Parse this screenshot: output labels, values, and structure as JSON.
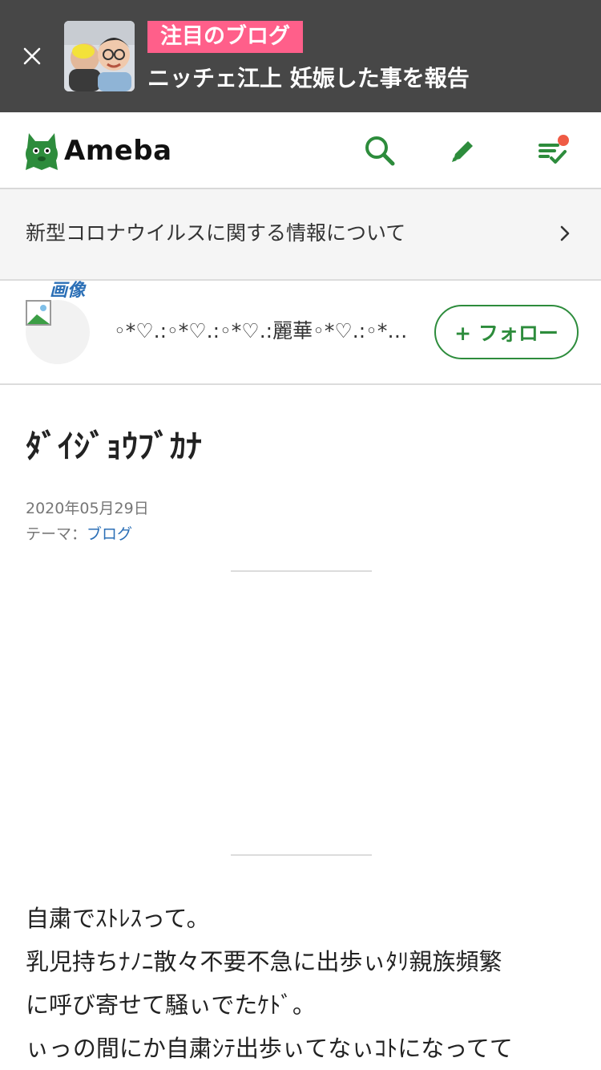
{
  "banner": {
    "tag": "注目のブログ",
    "headline": "ニッチェ江上 妊娠した事を報告"
  },
  "header": {
    "logo_text": "Ameba"
  },
  "info_bar": {
    "text": "新型コロナウイルスに関する情報について"
  },
  "blogger": {
    "avatar_alt": "画像",
    "blog_name": "◦*♡.:◦*♡.:◦*♡.:麗華◦*♡.:◦*♡.:◦*♡.:",
    "follow_label": "+ フォロー"
  },
  "article": {
    "title": "ﾀﾞｲｼﾞｮｳﾌﾞｶﾅ",
    "date": "2020年05月29日",
    "theme_label": "テーマ：",
    "theme_link": "ブログ",
    "body_lines": [
      "自粛でｽﾄﾚｽって。",
      "乳児持ちﾅﾉﾆ散々不要不急に出歩ぃﾀﾘ親族頻繁",
      "に呼び寄せて騒ぃでたｹﾄﾞ。",
      "ぃっの間にか自粛ｼﾃ出歩ぃてなぃｺﾄになってて"
    ]
  },
  "colors": {
    "banner_bg": "#474747",
    "tag_bg": "#ff5f8a",
    "brand_green": "#2d8c3c",
    "link_blue": "#2b6fb6",
    "notification_dot": "#ef5b45"
  }
}
